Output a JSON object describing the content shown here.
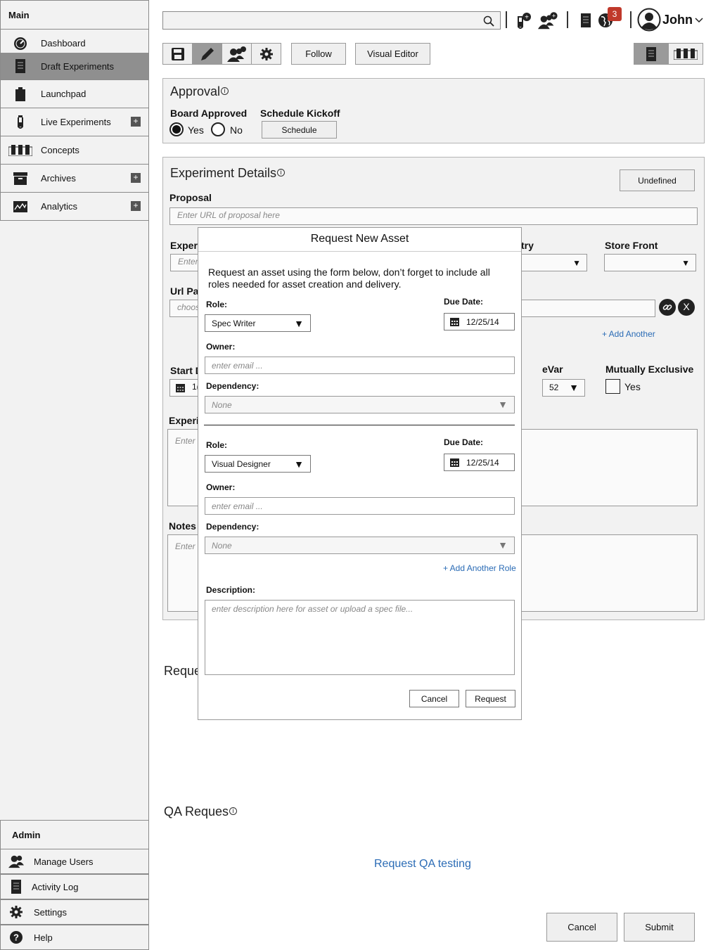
{
  "sidebar": {
    "main_label": "Main",
    "items": [
      {
        "label": "Dashboard",
        "icon": "gauge-icon"
      },
      {
        "label": "Draft Experiments",
        "icon": "notebook-icon"
      },
      {
        "label": "Launchpad",
        "icon": "clipboard-icon"
      },
      {
        "label": "Live Experiments",
        "icon": "flask-icon",
        "expand": "+"
      },
      {
        "label": "Concepts",
        "icon": "test-tubes-icon"
      },
      {
        "label": "Archives",
        "icon": "archive-box-icon",
        "expand": "+"
      },
      {
        "label": "Analytics",
        "icon": "line-chart-icon",
        "expand": "+"
      }
    ],
    "admin_label": "Admin",
    "admin_items": [
      {
        "label": "Manage Users",
        "icon": "users-icon"
      },
      {
        "label": "Activity Log",
        "icon": "log-icon"
      },
      {
        "label": "Settings",
        "icon": "gear-icon"
      },
      {
        "label": "Help",
        "icon": "help-icon"
      }
    ]
  },
  "topbar": {
    "search_placeholder": "",
    "notification_count": "3",
    "user_name": "John"
  },
  "toolbar": {
    "follow_label": "Follow",
    "visual_editor_label": "Visual Editor"
  },
  "approval": {
    "title": "Approval",
    "board_approved_label": "Board Approved",
    "yes_label": "Yes",
    "no_label": "No",
    "schedule_kickoff_label": "Schedule Kickoff",
    "schedule_button": "Schedule"
  },
  "details": {
    "title": "Experiment Details",
    "status_button": "Undefined",
    "proposal_label": "Proposal",
    "proposal_placeholder": "Enter URL of proposal here",
    "experiment_label_partial": "Exper",
    "experiment_placeholder_partial": "Enter",
    "country_label_partial": "try",
    "store_front_label": "Store Front",
    "url_label_partial": "Url Pa",
    "url_placeholder_partial": "choos",
    "add_another_link": "+ Add Another",
    "start_label_partial": "Start D",
    "start_value_partial": "1(",
    "evar_label": "eVar",
    "evar_value": "52",
    "mutually_exclusive_label": "Mutually Exclusive",
    "mutually_exclusive_yes": "Yes",
    "experiment_desc_label_partial": "Experi",
    "experiment_desc_placeholder_partial": "Enter",
    "notes_label": "Notes",
    "notes_placeholder_partial": "Enter"
  },
  "requests": {
    "title_partial": "Reque",
    "qa_title_partial": "QA Reques",
    "qa_link": "Request QA testing",
    "cancel_button": "Cancel",
    "submit_button": "Submit"
  },
  "modal": {
    "title": "Request New Asset",
    "intro": "Request an asset using the form below, don’t forget to include all roles needed for asset creation and delivery.",
    "role_label": "Role:",
    "due_date_label": "Due Date:",
    "owner_label": "Owner:",
    "dependency_label": "Dependency:",
    "roles": [
      {
        "role": "Spec Writer",
        "due_date": "12/25/14",
        "owner_placeholder": "enter email ...",
        "dependency": "None"
      },
      {
        "role": "Visual Designer",
        "due_date": "12/25/14",
        "owner_placeholder": "enter email ...",
        "dependency": "None"
      }
    ],
    "add_role_link": "+ Add Another Role",
    "description_label": "Description:",
    "description_placeholder": "enter description here for asset or upload a spec file...",
    "cancel_button": "Cancel",
    "request_button": "Request"
  }
}
